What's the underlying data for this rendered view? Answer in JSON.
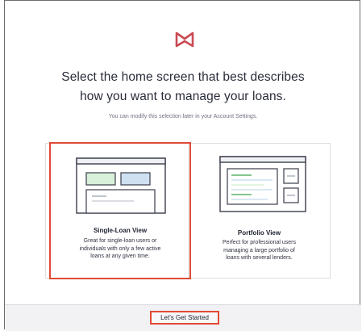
{
  "headline": {
    "line1": "Select the home screen that best describes",
    "line2": "how you want to manage your loans."
  },
  "subtext": "You can modify this selection later in your Account Settings.",
  "options": [
    {
      "title": "Single-Loan View",
      "description": [
        "Great for single-loan users or",
        "individuals with only a few active",
        "loans at any given time."
      ],
      "selected": true
    },
    {
      "title": "Portfolio View",
      "description": [
        "Perfect for professional users",
        "managing a large portfolio of",
        "loans with several lenders."
      ],
      "selected": false
    }
  ],
  "footer": {
    "start_label": "Let's Get Started"
  },
  "colors": {
    "accent": "#e04a34",
    "logo": "#c94a54",
    "illus_blue": "#cfe0f0",
    "illus_green": "#d8efd9",
    "illus_border": "#3a3d4a"
  },
  "icons": {
    "logo": "brand-logo-icon"
  }
}
